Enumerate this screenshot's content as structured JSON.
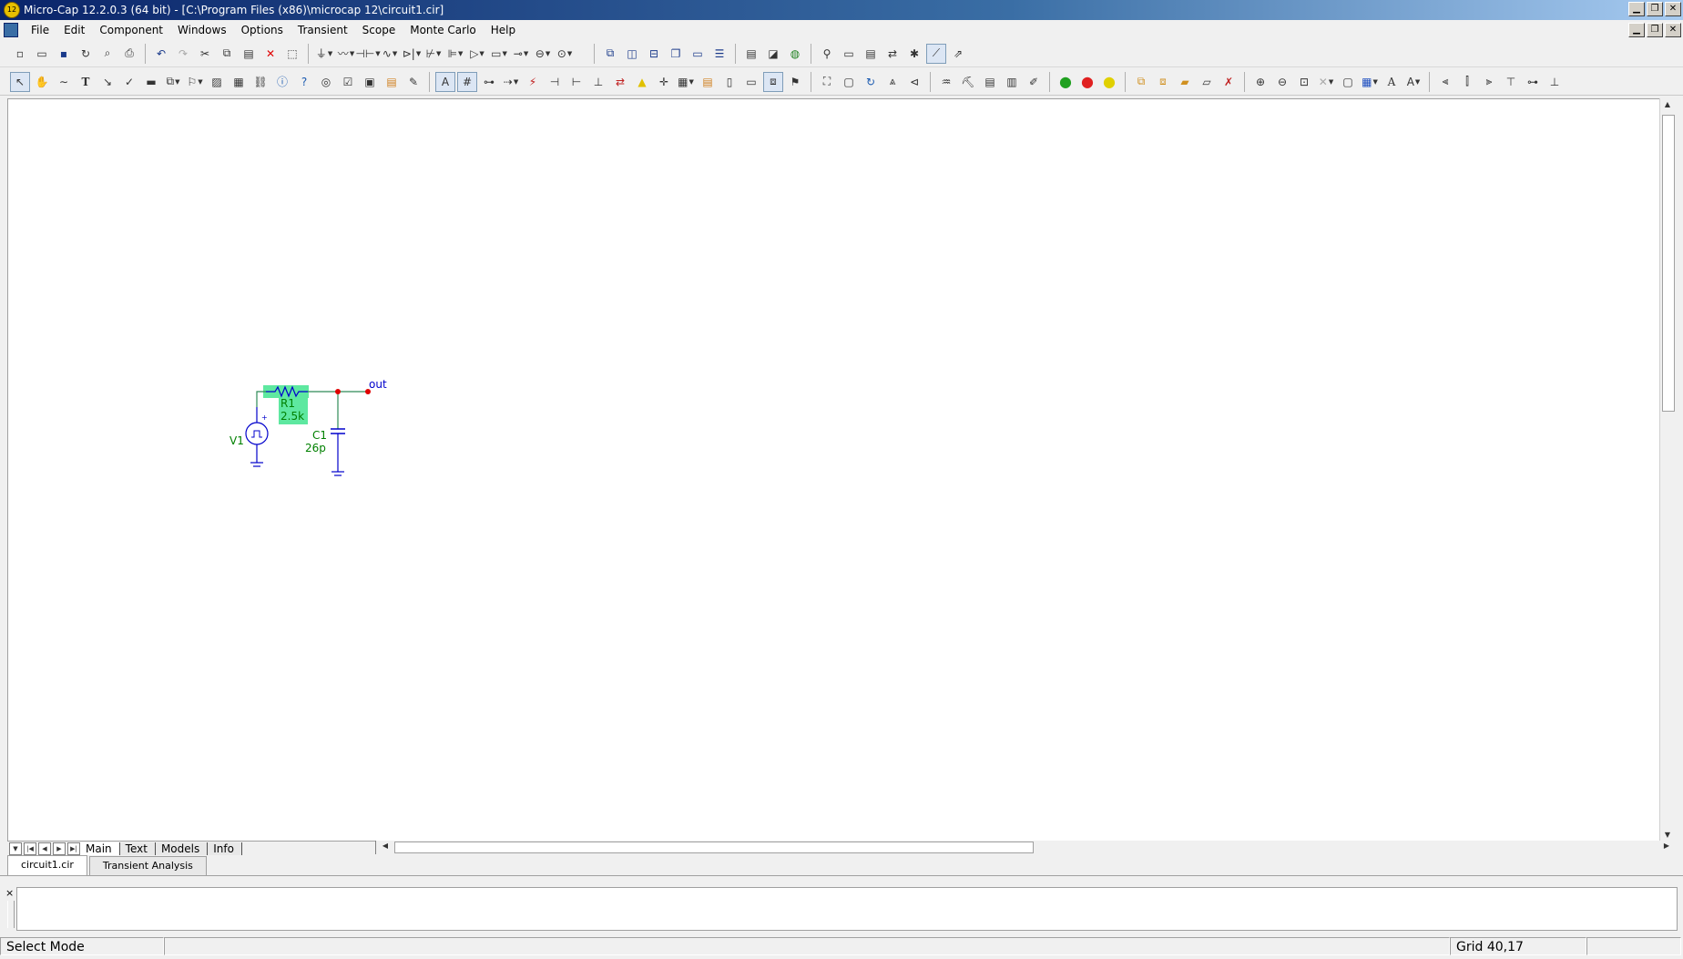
{
  "window": {
    "title": "Micro-Cap 12.2.0.3 (64 bit) - [C:\\Program Files (x86)\\microcap 12\\circuit1.cir]",
    "app_icon_text": "12"
  },
  "menubar": {
    "items": [
      "File",
      "Edit",
      "Component",
      "Windows",
      "Options",
      "Transient",
      "Scope",
      "Monte Carlo",
      "Help"
    ]
  },
  "toolbar1": {
    "icons": [
      "new-file-icon",
      "open-file-icon",
      "save-icon",
      "revert-icon",
      "print-preview-icon",
      "print-icon",
      "undo-icon",
      "redo-icon",
      "cut-icon",
      "copy-icon",
      "paste-icon",
      "delete-icon",
      "select-all-icon",
      "ground-icon",
      "resistor-icon",
      "capacitor-icon",
      "inductor-icon",
      "diode-icon",
      "bjt-icon",
      "mosfet-icon",
      "opamp-icon",
      "subckt-icon",
      "switch-icon",
      "voltage-source-icon",
      "current-source-icon",
      "cascade-icon",
      "tile-vertical-icon",
      "tile-horizontal-icon",
      "restore-icon",
      "maximize-icon",
      "list-icon",
      "component-editor-icon",
      "shape-editor-icon",
      "model-icon",
      "probe-icon",
      "analysis-limits-icon",
      "transient-icon",
      "ac-icon",
      "dc-icon",
      "plot-icon",
      "stepping-icon"
    ]
  },
  "toolbar2": {
    "icons": [
      "select-mode-icon",
      "pan-mode-icon",
      "wire-mode-icon",
      "text-mode-icon",
      "diagonal-wire-icon",
      "bezier-icon",
      "bus-icon",
      "macro-icon",
      "flag-icon",
      "picture-icon",
      "table-icon",
      "link-icon",
      "info-icon",
      "help-icon",
      "point-to-end-icon",
      "checkbox-icon",
      "grid-text-icon",
      "attribute-icon",
      "edit-text-icon",
      "text-attr-icon",
      "node-numbers-icon",
      "pin-connections-icon",
      "current-icon",
      "voltage-icon",
      "power-icon",
      "conditions-icon",
      "warning-icon",
      "crosshair-icon",
      "grid-icon",
      "page-icon",
      "doc-icon",
      "box-icon",
      "rotate-icon",
      "flip-x-icon",
      "flip-y-icon",
      "find-icon",
      "replace-icon",
      "green-run-icon",
      "red-stop-icon",
      "yellow-dots-icon",
      "group-icon",
      "ungroup-icon",
      "cleanup-icon",
      "zoom-in-icon",
      "zoom-out-icon",
      "zoom-fit-icon",
      "color-icon",
      "font-icon",
      "align-left-icon",
      "align-center-icon",
      "align-right-icon",
      "align-top-icon",
      "align-middle-icon",
      "align-bottom-icon"
    ]
  },
  "schematic": {
    "node_label_out": "out",
    "components": [
      {
        "ref": "R1",
        "value": "2.5k"
      },
      {
        "ref": "C1",
        "value": "26p"
      },
      {
        "ref": "V1",
        "value": ""
      }
    ],
    "colors": {
      "wire": "#2e8b57",
      "component": "#0000cc",
      "label": "#008000",
      "highlight": "#5ee8a0",
      "node": "#e00000",
      "out_label": "#0000cc"
    }
  },
  "sheet_tabs": [
    "Main",
    "Text",
    "Models",
    "Info"
  ],
  "doc_tabs": [
    "circuit1.cir",
    "Transient Analysis"
  ],
  "output_panel": {
    "close_label": "×",
    "text": ""
  },
  "status": {
    "mode": "Select Mode",
    "grid": "Grid 40,17"
  }
}
